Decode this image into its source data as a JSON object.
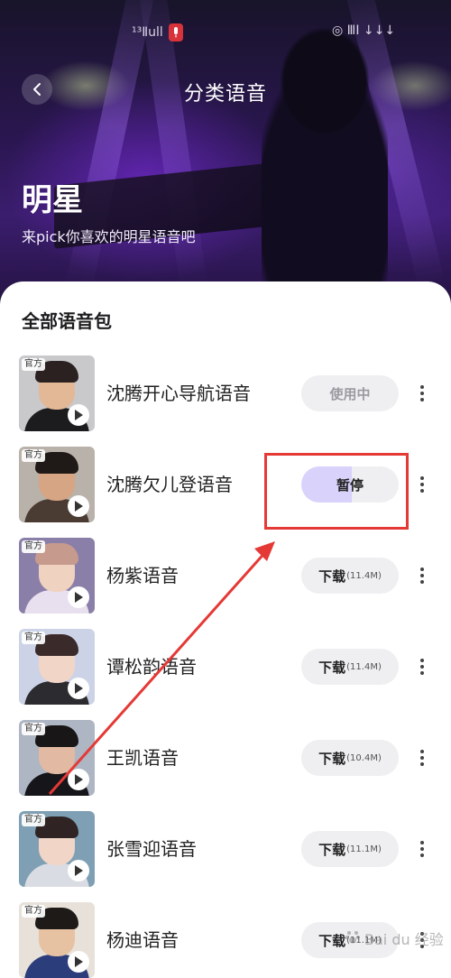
{
  "status_bar": {
    "left_text": "¹³Ⅱull",
    "right_text": "◎ ⅢⅠ ↓↓↓"
  },
  "header": {
    "title": "分类语音",
    "category_title": "明星",
    "category_subtitle": "来pick你喜欢的明星语音吧"
  },
  "section_title": "全部语音包",
  "items": [
    {
      "badge": "官方",
      "name": "沈腾开心导航语音",
      "action": "使用中",
      "size": "",
      "state": "using",
      "colors": {
        "bg": "#c9c9cc",
        "skin": "#e3b896",
        "hair": "#2b2120",
        "body": "#1c1c1f"
      }
    },
    {
      "badge": "官方",
      "name": "沈腾欠儿登语音",
      "action": "暂停",
      "size": "",
      "state": "paused",
      "progress": 0.52,
      "colors": {
        "bg": "#b9b2aa",
        "skin": "#d6a583",
        "hair": "#1f1917",
        "body": "#4a3b33"
      }
    },
    {
      "badge": "官方",
      "name": "杨紫语音",
      "action": "下载",
      "size": "(11.4M)",
      "state": "download",
      "colors": {
        "bg": "#8a7fa8",
        "skin": "#f0d2c0",
        "hair": "#c79a8e",
        "body": "#e8e0ee"
      }
    },
    {
      "badge": "官方",
      "name": "谭松韵语音",
      "action": "下载",
      "size": "(11.4M)",
      "state": "download",
      "colors": {
        "bg": "#cdd3e6",
        "skin": "#f1d5c7",
        "hair": "#3a2a2a",
        "body": "#2b2b30"
      }
    },
    {
      "badge": "官方",
      "name": "王凯语音",
      "action": "下载",
      "size": "(10.4M)",
      "state": "download",
      "colors": {
        "bg": "#aeb6c4",
        "skin": "#e2b9a2",
        "hair": "#181616",
        "body": "#15151a"
      }
    },
    {
      "badge": "官方",
      "name": "张雪迎语音",
      "action": "下载",
      "size": "(11.1M)",
      "state": "download",
      "colors": {
        "bg": "#7fa0b4",
        "skin": "#f1d6c8",
        "hair": "#2f2423",
        "body": "#d9dde3"
      }
    },
    {
      "badge": "官方",
      "name": "杨迪语音",
      "action": "下载",
      "size": "(11.1M)",
      "state": "download",
      "colors": {
        "bg": "#e7e1d9",
        "skin": "#e6c2a3",
        "hair": "#1e1a18",
        "body": "#2b3d7a"
      }
    }
  ],
  "watermark": "Bai du 经验",
  "colors": {
    "accent": "#e53935",
    "pause_fill": "#d9d2fb",
    "button_bg": "#efeff2"
  },
  "icons": {
    "back": "chevron-left-icon",
    "play": "play-icon",
    "more": "more-vertical-icon"
  }
}
